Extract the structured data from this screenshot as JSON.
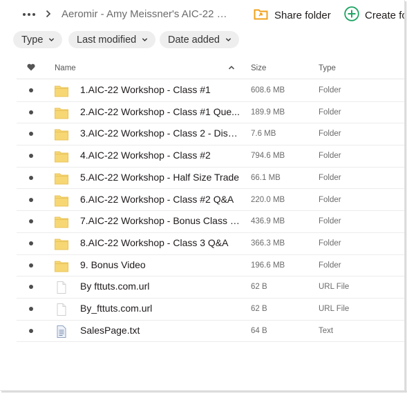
{
  "breadcrumb": {
    "path": "Aeromir - Amy Meissner's AIC-22 Wo..."
  },
  "actions": {
    "share_label": "Share folder",
    "create_label": "Create fo"
  },
  "filters": [
    "Type",
    "Last modified",
    "Date added"
  ],
  "columns": {
    "name": "Name",
    "size": "Size",
    "type": "Type"
  },
  "colors": {
    "folder": "#f7d774",
    "accent_green": "#1ea362",
    "share_orange": "#f2a21b"
  },
  "rows": [
    {
      "name": "1.AIC-22 Workshop - Class #1",
      "size": "608.6 MB",
      "type": "Folder",
      "icon": "folder-icon"
    },
    {
      "name": "2.AIC-22 Workshop - Class #1 Que...",
      "size": "189.9 MB",
      "type": "Folder",
      "icon": "folder-icon"
    },
    {
      "name": "3.AIC-22 Workshop - Class 2 - Disc...",
      "size": "7.6 MB",
      "type": "Folder",
      "icon": "folder-icon"
    },
    {
      "name": "4.AIC-22 Workshop - Class #2",
      "size": "794.6 MB",
      "type": "Folder",
      "icon": "folder-icon"
    },
    {
      "name": "5.AIC-22 Workshop - Half Size Trade",
      "size": "66.1 MB",
      "type": "Folder",
      "icon": "folder-icon"
    },
    {
      "name": "6.AIC-22 Workshop - Class #2 Q&A",
      "size": "220.0 MB",
      "type": "Folder",
      "icon": "folder-icon"
    },
    {
      "name": "7.AIC-22 Workshop - Bonus Class - ...",
      "size": "436.9 MB",
      "type": "Folder",
      "icon": "folder-icon"
    },
    {
      "name": "8.AIC-22 Workshop - Class 3 Q&A",
      "size": "366.3 MB",
      "type": "Folder",
      "icon": "folder-icon"
    },
    {
      "name": "9. Bonus Video",
      "size": "196.6 MB",
      "type": "Folder",
      "icon": "folder-icon"
    },
    {
      "name": "By fttuts.com.url",
      "size": "62 B",
      "type": "URL File",
      "icon": "file-icon"
    },
    {
      "name": "By_fttuts.com.url",
      "size": "62 B",
      "type": "URL File",
      "icon": "file-icon"
    },
    {
      "name": "SalesPage.txt",
      "size": "64 B",
      "type": "Text",
      "icon": "text-file-icon"
    }
  ]
}
